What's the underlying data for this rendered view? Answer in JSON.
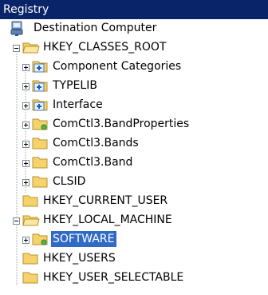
{
  "window": {
    "title": "Registry"
  },
  "tree": {
    "root": {
      "label": "Destination Computer",
      "icon": "computer-icon"
    },
    "items": [
      {
        "label": "HKEY_CLASSES_ROOT",
        "icon": "folder-open-icon",
        "expander": "minus"
      },
      {
        "label": "Component Categories",
        "icon": "folder-plus-icon",
        "expander": "plus"
      },
      {
        "label": "TYPELIB",
        "icon": "folder-plus-icon",
        "expander": "plus"
      },
      {
        "label": "Interface",
        "icon": "folder-plus-icon",
        "expander": "plus"
      },
      {
        "label": "ComCtl3.BandProperties",
        "icon": "folder-green-dot-icon",
        "expander": "plus"
      },
      {
        "label": "ComCtl3.Bands",
        "icon": "folder-icon",
        "expander": "plus"
      },
      {
        "label": "ComCtl3.Band",
        "icon": "folder-icon",
        "expander": "plus"
      },
      {
        "label": "CLSID",
        "icon": "folder-icon",
        "expander": "plus"
      },
      {
        "label": "HKEY_CURRENT_USER",
        "icon": "folder-icon",
        "expander": ""
      },
      {
        "label": "HKEY_LOCAL_MACHINE",
        "icon": "folder-open-icon",
        "expander": "minus"
      },
      {
        "label": "SOFTWARE",
        "icon": "folder-green-dot-icon",
        "expander": "plus",
        "selected": true
      },
      {
        "label": "HKEY_USERS",
        "icon": "folder-icon",
        "expander": ""
      },
      {
        "label": "HKEY_USER_SELECTABLE",
        "icon": "folder-icon",
        "expander": ""
      }
    ]
  },
  "colors": {
    "title_bar": "#0a246a",
    "selection": "#316ac5",
    "folder_fill": "#f7d774",
    "folder_edge": "#c29b2a"
  }
}
